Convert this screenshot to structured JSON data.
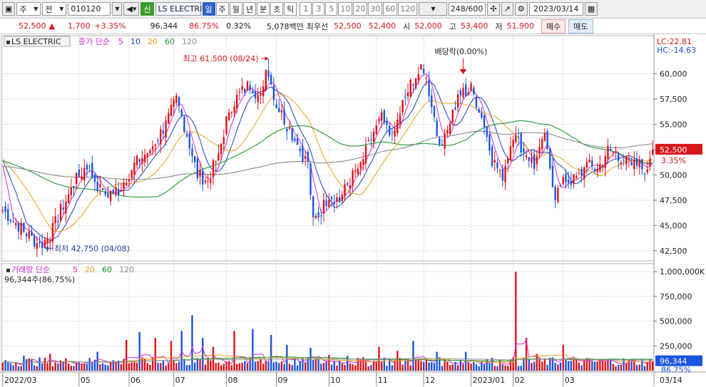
{
  "toolbar": {
    "market": "주",
    "prev": "전",
    "code": "010120",
    "badge": "신",
    "name": "LS ELECTRI",
    "periods": [
      "일",
      "주",
      "월",
      "년",
      "분",
      "초",
      "틱"
    ],
    "active_period": "일",
    "nums": [
      "1",
      "3",
      "5",
      "10",
      "20",
      "30",
      "60",
      "120"
    ],
    "count": "248/600",
    "date": "2023/03/14"
  },
  "quote": {
    "price": "52,500",
    "change": "1,700",
    "change_pct": "+3.35%",
    "volume": "96,344",
    "vol_ratio": "86.75%",
    "turnover": "0.32%",
    "amount": "5,078백만",
    "best_label": "최우선",
    "ask": "52,500",
    "bid": "52,400",
    "open_label": "시",
    "open": "52,000",
    "high_label": "고",
    "high": "53,400",
    "low_label": "저",
    "low": "51,900",
    "buy": "매수",
    "sell": "매도"
  },
  "price_panel": {
    "name_tag": "LS ELECTRIC",
    "legend_prefix": "종가 단순",
    "ma_labels": [
      "5",
      "10",
      "20",
      "60",
      "120"
    ],
    "ma_colors": [
      "#d62ad4",
      "#1f3fbf",
      "#e8a31a",
      "#1a9a2a",
      "#8a8a8a"
    ],
    "lc": "LC:22.81",
    "hc": "HC:-14.63",
    "last_label": "52,500",
    "last_pct": "3.35%",
    "max_note": "최고 61,500 (08/24)",
    "min_note": "최저 42,750 (04/08)",
    "div_note": "배당락(0.00%)"
  },
  "volume_panel": {
    "legend_prefix": "거래량 단순",
    "ma_labels": [
      "5",
      "20",
      "60",
      "120"
    ],
    "info": "96,344주(86.75%)",
    "last_label": "96,344",
    "last_pct": "86.75%"
  },
  "chart_data": [
    {
      "type": "candlestick",
      "title": "LS ELECTRIC",
      "ylim": [
        41500,
        62500
      ],
      "y_ticks": [
        "42,500",
        "45,000",
        "47,500",
        "50,000",
        "52,500",
        "55,000",
        "57,500",
        "60,000"
      ],
      "y_tick_values": [
        42500,
        45000,
        47500,
        50000,
        52500,
        55000,
        57500,
        60000
      ],
      "x_ticks": [
        "2022/03",
        "05",
        "06",
        "07",
        "08",
        "09",
        "10",
        "11",
        "12",
        "2023/01",
        "02",
        "03",
        "03/14"
      ],
      "x_tick_bar_index": [
        0,
        29,
        48,
        65,
        85,
        104,
        124,
        142,
        160,
        178,
        194,
        213,
        247
      ],
      "bars": 248,
      "anchors_close": [
        [
          0,
          46500
        ],
        [
          8,
          44500
        ],
        [
          14,
          43000
        ],
        [
          18,
          44000
        ],
        [
          22,
          46500
        ],
        [
          28,
          49500
        ],
        [
          32,
          51000
        ],
        [
          38,
          48000
        ],
        [
          44,
          48500
        ],
        [
          50,
          51000
        ],
        [
          56,
          52500
        ],
        [
          62,
          55000
        ],
        [
          66,
          57500
        ],
        [
          70,
          54000
        ],
        [
          74,
          50000
        ],
        [
          78,
          49500
        ],
        [
          82,
          52000
        ],
        [
          86,
          56500
        ],
        [
          90,
          58000
        ],
        [
          94,
          59000
        ],
        [
          98,
          57500
        ],
        [
          100,
          61000
        ],
        [
          104,
          57000
        ],
        [
          108,
          55000
        ],
        [
          112,
          53000
        ],
        [
          116,
          51000
        ],
        [
          118,
          45500
        ],
        [
          120,
          46000
        ],
        [
          124,
          48000
        ],
        [
          128,
          47500
        ],
        [
          132,
          49500
        ],
        [
          136,
          51000
        ],
        [
          140,
          53500
        ],
        [
          144,
          55500
        ],
        [
          148,
          53500
        ],
        [
          152,
          57000
        ],
        [
          156,
          59500
        ],
        [
          160,
          60500
        ],
        [
          164,
          56000
        ],
        [
          166,
          53000
        ],
        [
          170,
          55500
        ],
        [
          174,
          58000
        ],
        [
          178,
          58500
        ],
        [
          182,
          56000
        ],
        [
          186,
          51500
        ],
        [
          190,
          50000
        ],
        [
          194,
          54000
        ],
        [
          198,
          52500
        ],
        [
          202,
          51000
        ],
        [
          206,
          53500
        ],
        [
          210,
          48000
        ],
        [
          214,
          49500
        ],
        [
          218,
          49500
        ],
        [
          222,
          51000
        ],
        [
          226,
          50500
        ],
        [
          230,
          52500
        ],
        [
          234,
          52000
        ],
        [
          238,
          51000
        ],
        [
          242,
          51000
        ],
        [
          244,
          50500
        ],
        [
          247,
          52500
        ]
      ],
      "max": {
        "value": 61500,
        "date": "08/24",
        "bar_index": 101
      },
      "min": {
        "value": 42750,
        "date": "04/08",
        "bar_index": 16
      },
      "dividend_bar_index": 175,
      "moving_averages": [
        5,
        10,
        20,
        60,
        120
      ]
    },
    {
      "type": "bar",
      "title": "거래량",
      "ylim": [
        0,
        1080000
      ],
      "y_ticks": [
        "250,000",
        "500,000",
        "750,000",
        "1,000,000K"
      ],
      "y_tick_values": [
        250000,
        500000,
        750000,
        1000000
      ],
      "base_volume": 85000,
      "spikes": [
        [
          8,
          150000
        ],
        [
          18,
          170000
        ],
        [
          36,
          190000
        ],
        [
          47,
          310000
        ],
        [
          52,
          390000
        ],
        [
          58,
          330000
        ],
        [
          64,
          300000
        ],
        [
          68,
          400000
        ],
        [
          72,
          560000
        ],
        [
          76,
          330000
        ],
        [
          80,
          240000
        ],
        [
          88,
          400000
        ],
        [
          95,
          420000
        ],
        [
          102,
          360000
        ],
        [
          108,
          260000
        ],
        [
          117,
          230000
        ],
        [
          124,
          160000
        ],
        [
          131,
          150000
        ],
        [
          143,
          240000
        ],
        [
          150,
          200000
        ],
        [
          156,
          300000
        ],
        [
          165,
          190000
        ],
        [
          176,
          190000
        ],
        [
          195,
          1000000
        ],
        [
          199,
          330000
        ],
        [
          203,
          170000
        ],
        [
          213,
          260000
        ],
        [
          240,
          110000
        ],
        [
          247,
          96344
        ]
      ],
      "moving_averages": [
        5,
        20,
        60,
        120
      ]
    }
  ]
}
